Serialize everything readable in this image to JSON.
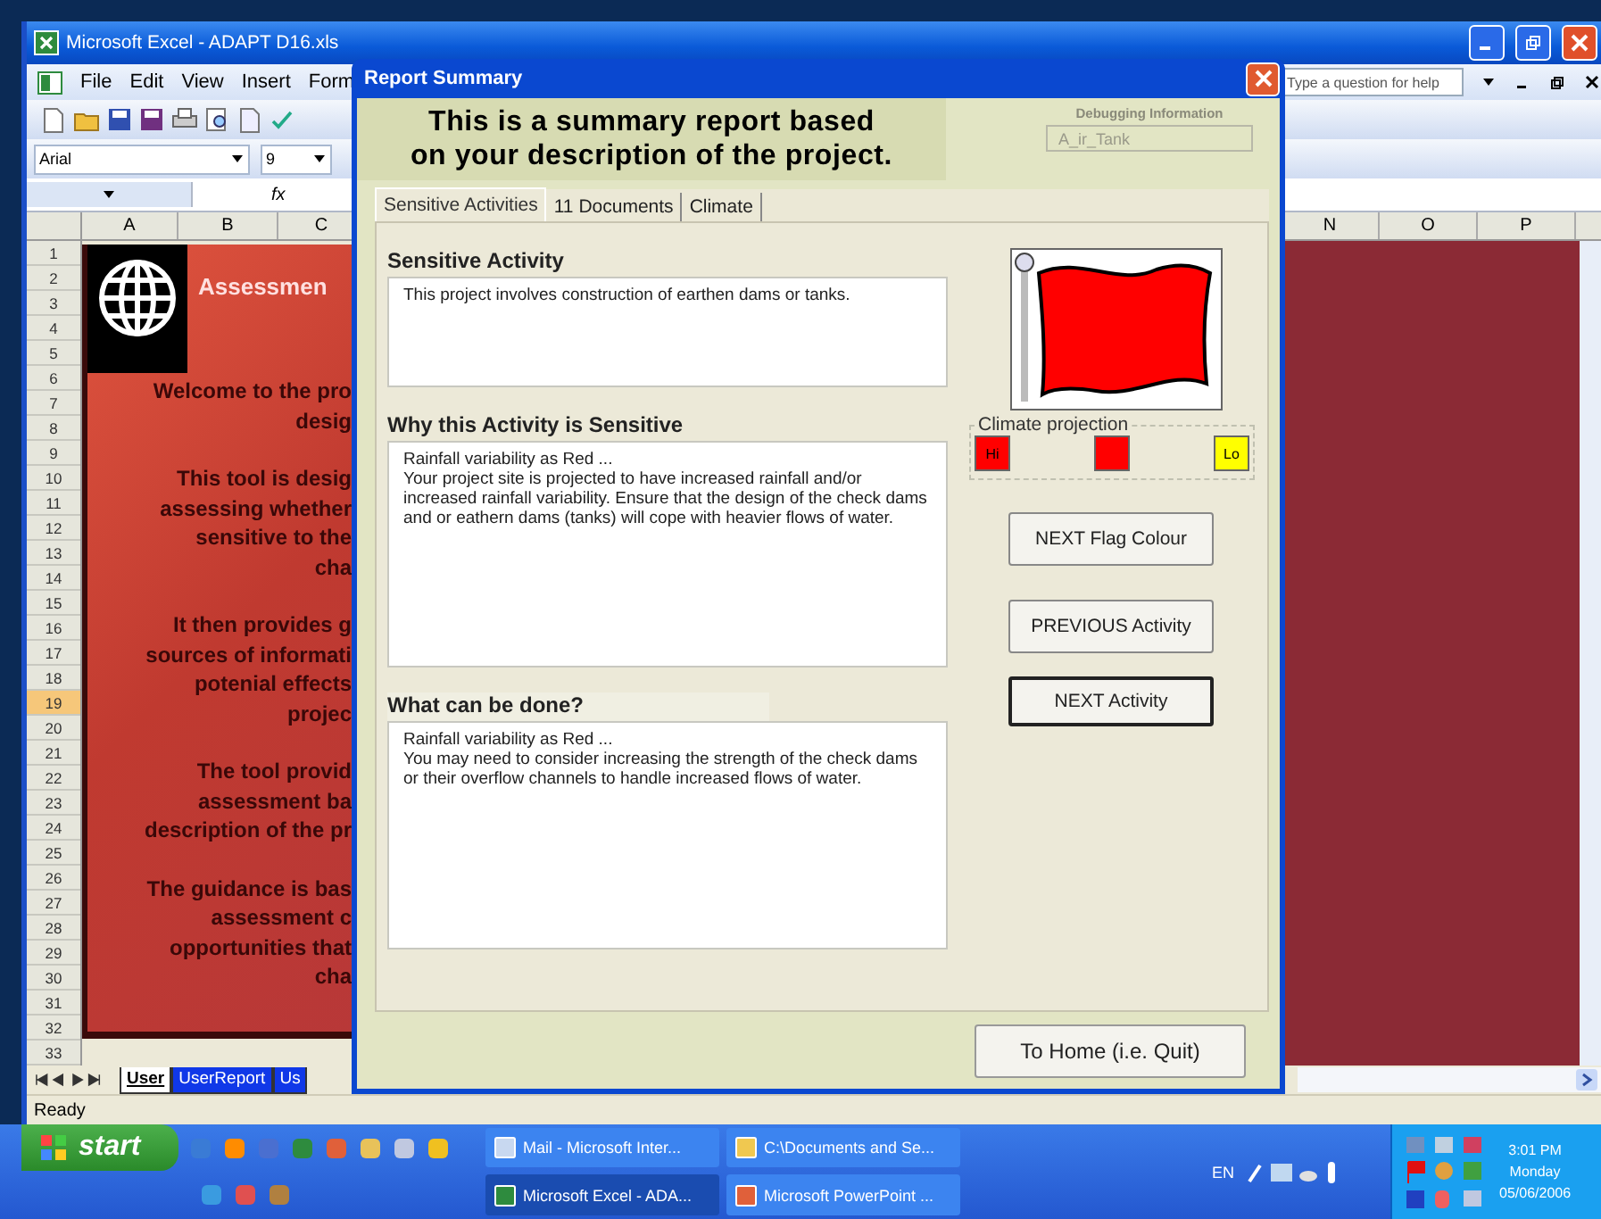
{
  "excel": {
    "title": "Microsoft Excel - ADAPT D16.xls",
    "menu": [
      "File",
      "Edit",
      "View",
      "Insert",
      "Form"
    ],
    "help_placeholder": "Type a question for help",
    "font": "Arial",
    "font_size": "9",
    "formula_label": "fx",
    "columns_left": [
      "A",
      "B",
      "C"
    ],
    "columns_right": [
      "N",
      "O",
      "P"
    ],
    "rows": [
      {
        "label": "1",
        "selected": false
      },
      {
        "label": "2",
        "selected": false
      },
      {
        "label": "3",
        "selected": false
      },
      {
        "label": "4",
        "selected": false
      },
      {
        "label": "5",
        "selected": false
      },
      {
        "label": "6",
        "selected": false
      },
      {
        "label": "7",
        "selected": false
      },
      {
        "label": "8",
        "selected": false
      },
      {
        "label": "9",
        "selected": false
      },
      {
        "label": "10",
        "selected": false
      },
      {
        "label": "11",
        "selected": false
      },
      {
        "label": "12",
        "selected": false
      },
      {
        "label": "13",
        "selected": false
      },
      {
        "label": "14",
        "selected": false
      },
      {
        "label": "15",
        "selected": false
      },
      {
        "label": "16",
        "selected": false
      },
      {
        "label": "17",
        "selected": false
      },
      {
        "label": "18",
        "selected": false
      },
      {
        "label": "19",
        "selected": true
      },
      {
        "label": "20",
        "selected": false
      },
      {
        "label": "21",
        "selected": false
      },
      {
        "label": "22",
        "selected": false
      },
      {
        "label": "23",
        "selected": false
      },
      {
        "label": "24",
        "selected": false
      },
      {
        "label": "25",
        "selected": false
      },
      {
        "label": "26",
        "selected": false
      },
      {
        "label": "27",
        "selected": false
      },
      {
        "label": "28",
        "selected": false
      },
      {
        "label": "29",
        "selected": false
      },
      {
        "label": "30",
        "selected": false
      },
      {
        "label": "31",
        "selected": false
      },
      {
        "label": "32",
        "selected": false
      },
      {
        "label": "33",
        "selected": false
      }
    ],
    "sheet": {
      "heading": "Assessmen",
      "paragraphs": [
        [
          "Welcome to the pro",
          "desig"
        ],
        [
          "This tool is desig",
          "assessing whether",
          "sensitive to the",
          "cha"
        ],
        [
          "It then provides g",
          "sources of informati",
          "potenial effects",
          "projec"
        ],
        [
          "The tool provid",
          "assessment ba",
          "description of the pr"
        ],
        [
          "The guidance is bas",
          "assessment c",
          "opportunities that",
          "cha"
        ]
      ]
    },
    "sheet_tabs": [
      {
        "label": "User",
        "selected": true
      },
      {
        "label": "UserReport",
        "selected": false
      },
      {
        "label": "Us",
        "selected": false
      }
    ],
    "status": "Ready"
  },
  "dialog": {
    "title": "Report Summary",
    "heading": [
      "This is a summary report based",
      "on your description of the project."
    ],
    "debug": {
      "label": "Debugging Information",
      "value": "A_ir_Tank"
    },
    "tabs": [
      {
        "label": "Sensitive Activities",
        "selected": true
      },
      {
        "label": "11 Documents",
        "selected": false
      },
      {
        "label": "Climate",
        "selected": false
      }
    ],
    "sections": [
      {
        "title": "Sensitive Activity",
        "lines": [
          "This project involves construction of earthen dams or tanks."
        ]
      },
      {
        "title": "Why this Activity is Sensitive",
        "lines": [
          "Rainfall variability as Red ...",
          "Your project site is projected to have increased rainfall and/or increased rainfall variability.  Ensure that the design of the check dams and or eathern dams (tanks) will cope with heavier flows of water."
        ]
      },
      {
        "title": "What can be done?",
        "lines": [
          "Rainfall variability as Red ...",
          "You may need to consider increasing the strength of the check dams or their overflow channels to handle increased flows of water."
        ]
      }
    ],
    "flag": {
      "color": "#ff0000"
    },
    "climate_projection": {
      "label": "Climate projection",
      "boxes": [
        {
          "label": "Hi",
          "color": "#ff0000"
        },
        {
          "color": "#ff0000"
        },
        {
          "label": "Lo",
          "color": "#ffff00"
        }
      ]
    },
    "buttons": [
      {
        "label": "NEXT Flag Colour",
        "focused": false
      },
      {
        "label": "PREVIOUS Activity",
        "focused": false
      },
      {
        "label": "NEXT Activity",
        "focused": true
      }
    ],
    "quit_button": "To Home (i.e. Quit)"
  },
  "taskbar": {
    "start": "start",
    "tasks": [
      {
        "label": "Mail - Microsoft Inter...",
        "kind": "mail",
        "selected": false
      },
      {
        "label": "C:\\Documents and Se...",
        "kind": "folder",
        "selected": false
      },
      {
        "label": "Microsoft Excel - ADA...",
        "kind": "excel",
        "selected": true
      },
      {
        "label": "Microsoft PowerPoint ...",
        "kind": "powerpoint",
        "selected": false
      }
    ],
    "language": "EN",
    "clock": [
      "3:01 PM",
      "Monday",
      "05/06/2006"
    ]
  }
}
